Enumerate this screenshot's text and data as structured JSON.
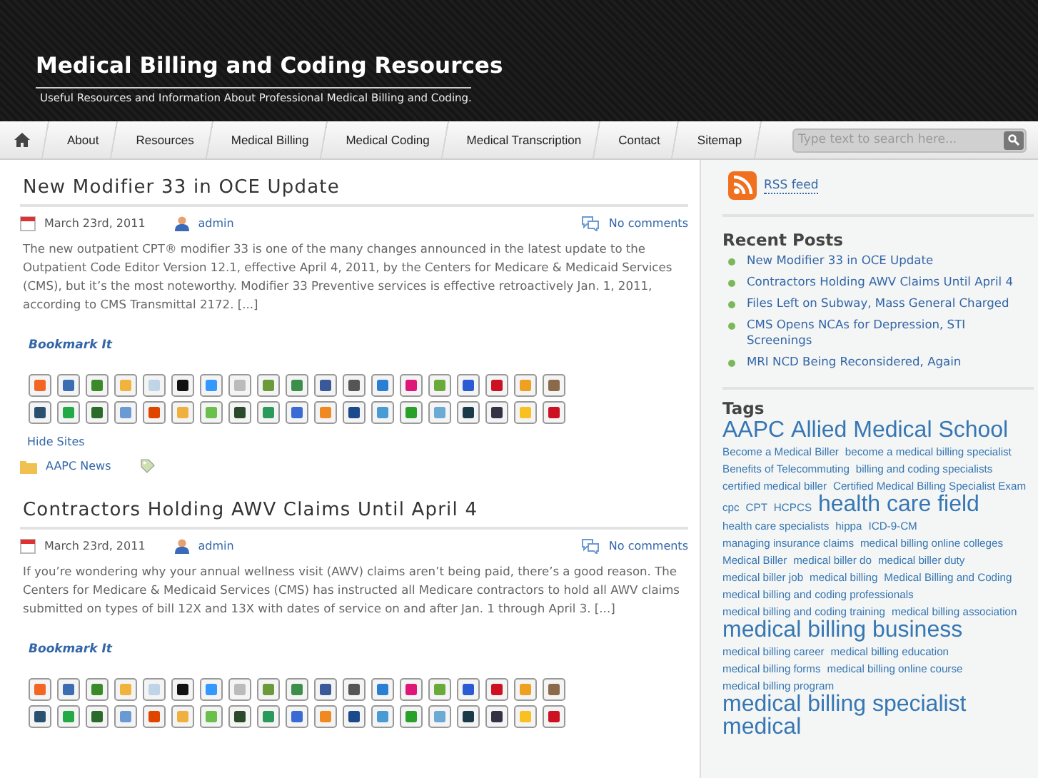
{
  "site": {
    "title": "Medical Billing and Coding Resources",
    "tagline": "Useful Resources and Information About Professional Medical Billing and Coding."
  },
  "nav": {
    "items": [
      {
        "label": "About",
        "selected": false
      },
      {
        "label": "Resources",
        "selected": false
      },
      {
        "label": "Medical Billing",
        "selected": false
      },
      {
        "label": "Medical Coding",
        "selected": false
      },
      {
        "label": "Medical Transcription",
        "selected": false
      },
      {
        "label": "Contact",
        "selected": false
      },
      {
        "label": "Sitemap",
        "selected": false
      }
    ],
    "search": {
      "placeholder": "Type text to search here..."
    }
  },
  "posts": [
    {
      "title": "New Modifier 33 in OCE Update",
      "date": "March 23rd, 2011",
      "author": "admin",
      "comments": "No comments",
      "excerpt": "The new outpatient CPT® modifier 33 is one of the many changes announced in the latest update to the Outpatient Code Editor Version 12.1, effective April 4, 2011, by the Centers for Medicare & Medicaid Services (CMS), but it’s the most noteworthy. Modifier 33 Preventive services is effective retroactively Jan. 1, 2011, according to CMS Transmittal 2172. [...]",
      "bookmark_label": "Bookmark It",
      "hide_sites": "Hide Sites",
      "category": "AAPC News"
    },
    {
      "title": "Contractors Holding AWV Claims Until April 4",
      "date": "March 23rd, 2011",
      "author": "admin",
      "comments": "No comments",
      "excerpt": "If you’re wondering why your annual wellness visit (AWV) claims aren’t being paid, there’s a good reason. The Centers for Medicare & Medicaid Services (CMS) has instructed all Medicare contractors to hold all AWV claims submitted on types of bill 12X and 13X with dates of service on and after Jan. 1 through April 3. [...]",
      "bookmark_label": "Bookmark It"
    }
  ],
  "sidebar": {
    "rss": "RSS feed",
    "recent_posts": {
      "title": "Recent Posts",
      "items": [
        "New Modifier 33 in OCE Update",
        "Contractors Holding AWV Claims Until April 4",
        "Files Left on Subway, Mass General Charged",
        "CMS Opens NCAs for Depression, STI Screenings",
        "MRI NCD Being Reconsidered, Again"
      ]
    },
    "tags": {
      "title": "Tags",
      "items": [
        {
          "label": "AAPC",
          "kind": "large"
        },
        {
          "label": "Allied Medical School",
          "kind": "large"
        },
        {
          "label": "Become a Medical Biller",
          "kind": "small"
        },
        {
          "label": "become a medical billing specialist",
          "kind": "small"
        },
        {
          "label": "Benefits of Telecommuting",
          "kind": "small"
        },
        {
          "label": "billing and coding specialists",
          "kind": "small"
        },
        {
          "label": "certified medical biller",
          "kind": "small"
        },
        {
          "label": "Certified Medical Billing Specialist Exam",
          "kind": "small"
        },
        {
          "label": "cpc",
          "kind": "small"
        },
        {
          "label": "CPT",
          "kind": "small"
        },
        {
          "label": "HCPCS",
          "kind": "small"
        },
        {
          "label": "health care field",
          "kind": "large"
        },
        {
          "label": "health care specialists",
          "kind": "small"
        },
        {
          "label": "hippa",
          "kind": "small"
        },
        {
          "label": "ICD-9-CM",
          "kind": "small"
        },
        {
          "label": "managing insurance claims",
          "kind": "small"
        },
        {
          "label": "medical billing online colleges",
          "kind": "small"
        },
        {
          "label": "Medical Biller",
          "kind": "small"
        },
        {
          "label": "medical biller do",
          "kind": "small"
        },
        {
          "label": "medical biller duty",
          "kind": "small"
        },
        {
          "label": "medical biller job",
          "kind": "small"
        },
        {
          "label": "medical billing",
          "kind": "small"
        },
        {
          "label": "Medical Billing and Coding",
          "kind": "small"
        },
        {
          "label": "medical billing and coding professionals",
          "kind": "small"
        },
        {
          "label": "medical billing and coding training",
          "kind": "small"
        },
        {
          "label": "medical billing association",
          "kind": "small"
        },
        {
          "label": "medical billing business",
          "kind": "large"
        },
        {
          "label": "medical billing career",
          "kind": "small"
        },
        {
          "label": "medical billing education",
          "kind": "small"
        },
        {
          "label": "medical billing forms",
          "kind": "small"
        },
        {
          "label": "medical billing online course",
          "kind": "small"
        },
        {
          "label": "medical billing program",
          "kind": "small"
        },
        {
          "label": "medical billing specialist",
          "kind": "large"
        },
        {
          "label": "medical",
          "kind": "large"
        }
      ]
    }
  }
}
